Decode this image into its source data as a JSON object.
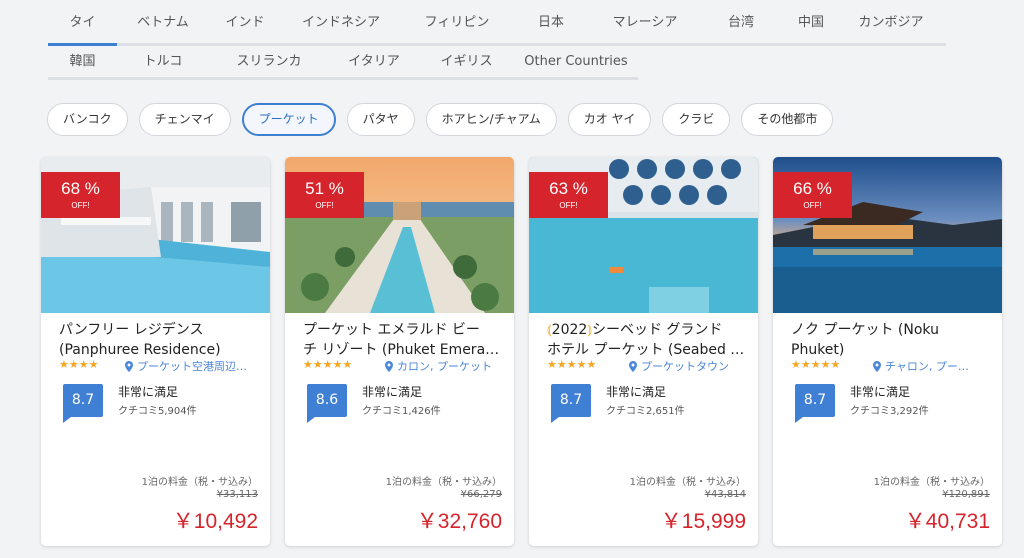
{
  "country_tabs_row1": [
    {
      "label": "タイ",
      "active": true
    },
    {
      "label": "ベトナム"
    },
    {
      "label": "インド"
    },
    {
      "label": "インドネシア"
    },
    {
      "label": "フィリピン"
    },
    {
      "label": "日本"
    },
    {
      "label": "マレーシア"
    },
    {
      "label": "台湾"
    },
    {
      "label": "中国"
    },
    {
      "label": "カンボジア"
    }
  ],
  "country_tabs_row2": [
    {
      "label": "韓国"
    },
    {
      "label": "トルコ"
    },
    {
      "label": "スリランカ"
    },
    {
      "label": "イタリア"
    },
    {
      "label": "イギリス"
    },
    {
      "label": "Other Countries"
    }
  ],
  "city_pills": [
    {
      "label": "バンコク"
    },
    {
      "label": "チェンマイ"
    },
    {
      "label": "プーケット",
      "active": true
    },
    {
      "label": "パタヤ"
    },
    {
      "label": "ホアヒン/チャアム"
    },
    {
      "label": "カオ ヤイ"
    },
    {
      "label": "クラビ"
    },
    {
      "label": "その他都市"
    }
  ],
  "colors": {
    "accent": "#3d7fd1",
    "discount": "#d6242c",
    "star": "#f5a623",
    "score": "#3f7fd4"
  },
  "hotels": [
    {
      "discount": "68 %",
      "off": "OFF!",
      "name_line1": "パンフリー レジデンス",
      "name_line2": "(Panphuree Residence)",
      "stars": "★★★★",
      "location": "プーケット空港周辺地域",
      "score": "8.7",
      "rating_label": "非常に満足",
      "reviews": "クチコミ5,904件",
      "price_label": "1泊の料金（税・サ込み）",
      "original_price": "¥33,113",
      "price": "￥10,492"
    },
    {
      "discount": "51 %",
      "off": "OFF!",
      "name_line1": "プーケット エメラルド ビー",
      "name_line2": "チ リゾート (Phuket Emerald Beach Resort)",
      "stars": "★★★★★",
      "location": "カロン, プーケット",
      "score": "8.6",
      "rating_label": "非常に満足",
      "reviews": "クチコミ1,426件",
      "price_label": "1泊の料金（税・サ込み）",
      "original_price": "¥66,279",
      "price": "￥32,760"
    },
    {
      "discount": "63 %",
      "off": "OFF!",
      "name_prefix": "2022",
      "name_line1": "シーベッド グランド",
      "name_line2": "ホテル プーケット (Seabed Grand Hotel Phuket)",
      "stars": "★★★★★",
      "location": "プーケットタウン",
      "score": "8.7",
      "rating_label": "非常に満足",
      "reviews": "クチコミ2,651件",
      "price_label": "1泊の料金（税・サ込み）",
      "original_price": "¥43,814",
      "price": "￥15,999"
    },
    {
      "discount": "66 %",
      "off": "OFF!",
      "name_line1": "ノク プーケット (Noku",
      "name_line2": "Phuket)",
      "stars": "★★★★★",
      "location": "チャロン, プーケット",
      "score": "8.7",
      "rating_label": "非常に満足",
      "reviews": "クチコミ3,292件",
      "price_label": "1泊の料金（税・サ込み）",
      "original_price": "¥120,891",
      "price": "￥40,731"
    }
  ]
}
